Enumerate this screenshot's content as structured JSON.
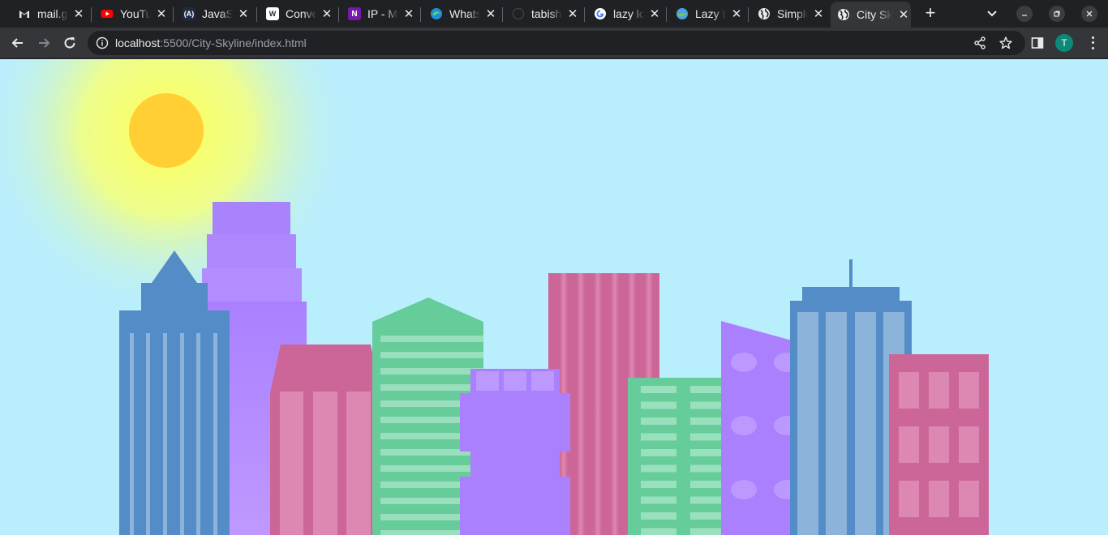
{
  "browser": {
    "tabs": [
      {
        "title": "mail.google.com",
        "favicon": "gmail-icon"
      },
      {
        "title": "YouTube",
        "favicon": "youtube-icon"
      },
      {
        "title": "JavaScript",
        "favicon": "angular-icon"
      },
      {
        "title": "Convert",
        "favicon": "w3-icon"
      },
      {
        "title": "IP - Microsoft OneNote",
        "favicon": "onenote-icon"
      },
      {
        "title": "WhatsApp",
        "favicon": "edge-icon"
      },
      {
        "title": "tabish",
        "favicon": "github-icon"
      },
      {
        "title": "lazy loading",
        "favicon": "google-icon"
      },
      {
        "title": "Lazy Loading",
        "favicon": "globe-color-icon"
      },
      {
        "title": "Simple",
        "favicon": "globe-icon"
      },
      {
        "title": "City Skyline",
        "favicon": "globe-icon",
        "active": true
      }
    ],
    "new_tab_label": "+",
    "url_host": "localhost",
    "url_rest": ":5500/City-Skyline/index.html",
    "profile_initial": "T"
  },
  "colors": {
    "sky": "#b9eefd",
    "sun": "#ffcf33",
    "sun_glow": "#ffff66",
    "building_blue": "#538cc6",
    "window_blue": "#8cb3d9",
    "building_purple": "#aa80ff",
    "building_pink": "#cc6699",
    "window_pink": "#dd88b3",
    "building_green": "#66cc99",
    "window_green": "#99e0bf"
  },
  "scene": {
    "title": "City Skyline",
    "elements": [
      "sun",
      "blue tower with spire",
      "stepped purple tower",
      "pink building",
      "green striped building",
      "purple block building",
      "pink striped tower",
      "green windowed building",
      "slanted purple building",
      "blue antenna tower",
      "pink windowed building"
    ]
  }
}
